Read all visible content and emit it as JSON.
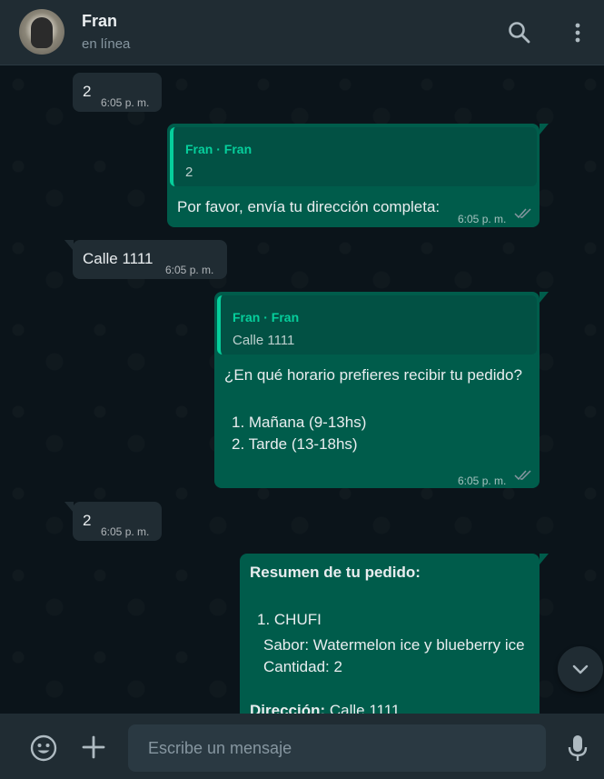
{
  "header": {
    "contact_name": "Fran",
    "contact_status": "en línea"
  },
  "messages": [
    {
      "direction": "in",
      "text": "2",
      "time": "6:05 p. m."
    },
    {
      "direction": "out",
      "quote_author": "Fran · Fran",
      "quote_text": "2",
      "text": "Por favor, envía tu dirección completa:",
      "time": "6:05 p. m.",
      "status": "read"
    },
    {
      "direction": "in",
      "text": "Calle 1111",
      "time": "6:05 p. m."
    },
    {
      "direction": "out",
      "quote_author": "Fran · Fran",
      "quote_text": "Calle 1111",
      "text": "¿En qué horario prefieres recibir tu pedido?",
      "options": [
        "1. Mañana (9-13hs)",
        "2. Tarde (13-18hs)"
      ],
      "time": "6:05 p. m.",
      "status": "read"
    },
    {
      "direction": "in",
      "text": "2",
      "time": "6:05 p. m."
    },
    {
      "direction": "out",
      "summary_title": "Resumen de tu pedido:",
      "item": "1. CHUFI",
      "flavor": "Sabor: Watermelon ice y blueberry ice",
      "quantity": "Cantidad: 2",
      "address_label": "Dirección:",
      "address_value": " Calle 1111"
    }
  ],
  "composer": {
    "placeholder": "Escribe un mensaje"
  },
  "icons": {
    "search": "search-icon",
    "menu": "kebab-menu-icon",
    "emoji": "emoji-icon",
    "attach": "plus-icon",
    "mic": "microphone-icon",
    "scroll": "chevron-down-icon"
  },
  "colors": {
    "accent": "#06cf9c",
    "outgoing_bubble": "#005c4b",
    "incoming_bubble": "#202c33",
    "read_ticks": "#8696a0"
  }
}
